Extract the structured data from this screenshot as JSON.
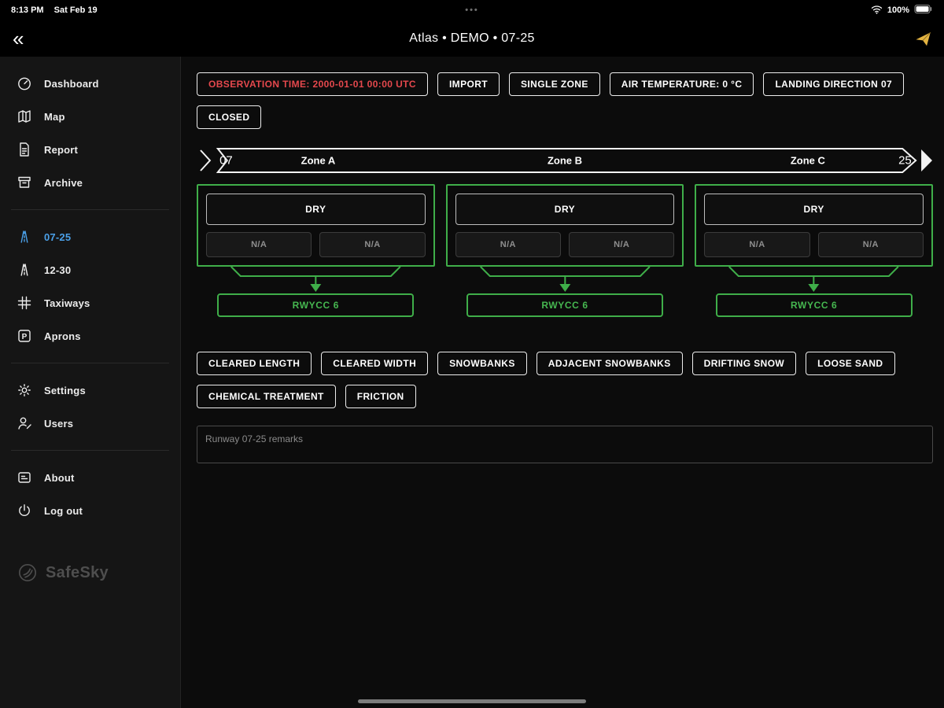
{
  "status_bar": {
    "time": "8:13 PM",
    "date": "Sat Feb 19",
    "handle_dots": "•••",
    "battery": "100%"
  },
  "header": {
    "back": "«",
    "title": "Atlas • DEMO • 07-25"
  },
  "sidebar": {
    "items": [
      {
        "label": "Dashboard"
      },
      {
        "label": "Map"
      },
      {
        "label": "Report"
      },
      {
        "label": "Archive"
      },
      {
        "label": "07-25"
      },
      {
        "label": "12-30"
      },
      {
        "label": "Taxiways"
      },
      {
        "label": "Aprons"
      },
      {
        "label": "Settings"
      },
      {
        "label": "Users"
      },
      {
        "label": "About"
      },
      {
        "label": "Log out"
      }
    ],
    "logo_text": "SafeSky"
  },
  "toolbar": {
    "observation_time": "OBSERVATION TIME: 2000-01-01 00:00 UTC",
    "import_label": "IMPORT",
    "single_zone": "SINGLE ZONE",
    "air_temperature": "AIR TEMPERATURE: 0 °C",
    "landing_direction": "LANDING DIRECTION 07",
    "closed": "CLOSED"
  },
  "runway_banner": {
    "left_designator": "07",
    "right_designator": "25",
    "zone_a": "Zone A",
    "zone_b": "Zone B",
    "zone_c": "Zone C"
  },
  "zones": [
    {
      "surface": "DRY",
      "na_left": "N/A",
      "na_right": "N/A",
      "rwycc": "RWYCC 6"
    },
    {
      "surface": "DRY",
      "na_left": "N/A",
      "na_right": "N/A",
      "rwycc": "RWYCC 6"
    },
    {
      "surface": "DRY",
      "na_left": "N/A",
      "na_right": "N/A",
      "rwycc": "RWYCC 6"
    }
  ],
  "condition_buttons": [
    "CLEARED LENGTH",
    "CLEARED WIDTH",
    "SNOWBANKS",
    "ADJACENT SNOWBANKS",
    "DRIFTING SNOW",
    "LOOSE SAND",
    "CHEMICAL TREATMENT",
    "FRICTION"
  ],
  "remarks": {
    "placeholder": "Runway 07-25 remarks"
  },
  "colors": {
    "accent_green": "#3fae49",
    "alert_red": "#e5484d",
    "active_blue": "#4ba0e8",
    "send_yellow": "#e3b341"
  }
}
